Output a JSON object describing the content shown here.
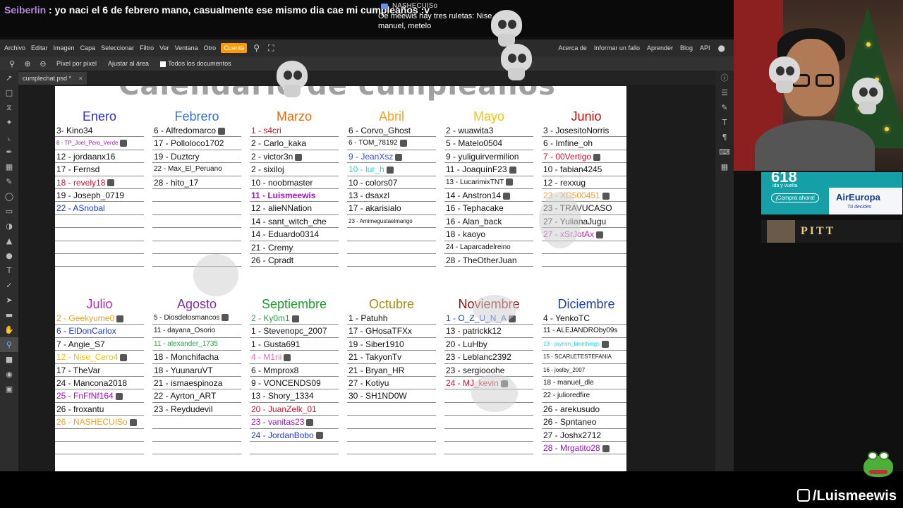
{
  "chat": {
    "username": "Seiberlin",
    "message": ": yo naci el 6 de febrero mano, casualmente ese mismo dia cae mi cumpleaños :v"
  },
  "popup": {
    "username": "NASHECUISo",
    "message": "Oe meewis hay tres ruletas: Nise manuel, metelo"
  },
  "menubar": {
    "items": [
      "Archivo",
      "Editar",
      "Imagen",
      "Capa",
      "Seleccionar",
      "Filtro",
      "Ver",
      "Ventana",
      "Otro",
      "Cuenta"
    ],
    "right_items": [
      "Acerca de",
      "Informar un fallo",
      "Aprender",
      "Blog",
      "API"
    ]
  },
  "optbar": {
    "pixel_label": "Píxel por píxel",
    "fit_label": "Ajustar al área",
    "all_docs_label": "Todos los documentos"
  },
  "tab": {
    "filename": "cumplechat.psd *",
    "close": "×"
  },
  "calendar": {
    "title": "Calendario de cumpleaños",
    "months": [
      {
        "name": "Enero",
        "color": "#2b2bd6",
        "entries": [
          {
            "t": "3- Kino34",
            "c": "#111"
          },
          {
            "t": "8 - TP_Joel_Pero_Verde",
            "c": "#9b1fb0",
            "s": "tiny",
            "a": 1
          },
          {
            "t": "12 - jordaanx16",
            "c": "#111"
          },
          {
            "t": "17 - Fernsd",
            "c": "#111"
          },
          {
            "t": "18 - revely18",
            "c": "#d01030",
            "a": 1
          },
          {
            "t": "19 - Joseph_0719",
            "c": "#111"
          },
          {
            "t": "22 - ASnobal",
            "c": "#1a3fc8"
          },
          {
            "t": "",
            "c": "#111"
          },
          {
            "t": "",
            "c": "#111"
          },
          {
            "t": "",
            "c": "#111"
          },
          {
            "t": "",
            "c": "#111"
          }
        ]
      },
      {
        "name": "Febrero",
        "color": "#3a6fd0",
        "entries": [
          {
            "t": "6 - Alfredomarco",
            "c": "#111",
            "a": 1
          },
          {
            "t": "17 - Polloloco1702",
            "c": "#111"
          },
          {
            "t": "19 - Duztcry",
            "c": "#111"
          },
          {
            "t": "22 - Max_El_Peruano",
            "c": "#111",
            "s": "small"
          },
          {
            "t": "28 - hito_17",
            "c": "#111"
          },
          {
            "t": "",
            "c": "#111"
          },
          {
            "t": "",
            "c": "#111"
          },
          {
            "t": "",
            "c": "#111"
          },
          {
            "t": "",
            "c": "#111"
          },
          {
            "t": "",
            "c": "#111"
          },
          {
            "t": "",
            "c": "#111"
          }
        ]
      },
      {
        "name": "Marzo",
        "color": "#e86a10",
        "entries": [
          {
            "t": "1 - s4cri",
            "c": "#d01030"
          },
          {
            "t": "2 - Carlo_kaka",
            "c": "#111"
          },
          {
            "t": "2 - victor3n",
            "c": "#111",
            "a": 1
          },
          {
            "t": "2 - sixiloj",
            "c": "#111"
          },
          {
            "t": "10 - noobmaster",
            "c": "#111"
          },
          {
            "t": "11 - Luismeewis",
            "c": "#a010c8",
            "b": 1
          },
          {
            "t": "12 - alieNNation",
            "c": "#111"
          },
          {
            "t": "14 - sant_witch_che",
            "c": "#111"
          },
          {
            "t": "14 - Eduardo0314",
            "c": "#111"
          },
          {
            "t": "21 - Cremy",
            "c": "#111"
          },
          {
            "t": "26 - Cpradt",
            "c": "#111"
          }
        ]
      },
      {
        "name": "Abril",
        "color": "#f0a020",
        "entries": [
          {
            "t": "6 - Corvo_Ghost",
            "c": "#111"
          },
          {
            "t": "6 - TOM_78192",
            "c": "#111",
            "s": "small",
            "a": 1
          },
          {
            "t": "9 - JeanXsz",
            "c": "#3050d0",
            "a": 1
          },
          {
            "t": "10 - lur_h",
            "c": "#20d0e0",
            "a": 1
          },
          {
            "t": "10 - colors07",
            "c": "#111"
          },
          {
            "t": "13 - dsaxzl",
            "c": "#111"
          },
          {
            "t": "17 - akarisialo",
            "c": "#111"
          },
          {
            "t": "23 - Amimegustaelmango",
            "c": "#111",
            "s": "tiny"
          },
          {
            "t": "",
            "c": "#111"
          },
          {
            "t": "",
            "c": "#111"
          },
          {
            "t": "",
            "c": "#111"
          }
        ]
      },
      {
        "name": "Mayo",
        "color": "#f0c400",
        "entries": [
          {
            "t": "2 - wuawita3",
            "c": "#111"
          },
          {
            "t": "5 - Matelo0504",
            "c": "#111"
          },
          {
            "t": "9 - yuliguirvermilion",
            "c": "#111"
          },
          {
            "t": "11 - JoaquínF23",
            "c": "#111",
            "a": 1
          },
          {
            "t": "13 - LucarimixTNT",
            "c": "#111",
            "s": "small",
            "a": 1
          },
          {
            "t": "14 - Anstron14",
            "c": "#111",
            "a": 1
          },
          {
            "t": "16 - Tephacake",
            "c": "#111"
          },
          {
            "t": "16 - Alan_back",
            "c": "#111"
          },
          {
            "t": "18 - kaoyo",
            "c": "#111"
          },
          {
            "t": "24 - Laparcadelreino",
            "c": "#111",
            "s": "small"
          },
          {
            "t": "28 - TheOtherJuan",
            "c": "#111"
          }
        ]
      },
      {
        "name": "Junio",
        "color": "#c01010",
        "entries": [
          {
            "t": "3 - JosesitoNorris",
            "c": "#111"
          },
          {
            "t": "6 - Imfine_oh",
            "c": "#111"
          },
          {
            "t": "7 - 00Vertigo",
            "c": "#d01030",
            "a": 1
          },
          {
            "t": "10 - fabian4245",
            "c": "#111"
          },
          {
            "t": "12 - rexxug",
            "c": "#111"
          },
          {
            "t": "23 - XD500451",
            "c": "#f0a020",
            "a": 1
          },
          {
            "t": "23 - TRAVUCASO",
            "c": "#111"
          },
          {
            "t": "27 - YulianaJugu",
            "c": "#111"
          },
          {
            "t": "27 - xSrJotAx",
            "c": "#c020c0",
            "a": 1
          },
          {
            "t": "",
            "c": "#111"
          },
          {
            "t": "",
            "c": "#111"
          }
        ]
      },
      {
        "name": "Julio",
        "color": "#c020c0",
        "entries": [
          {
            "t": "2 - Geekyume0",
            "c": "#f0a020",
            "a": 1
          },
          {
            "t": "6 - ElDonCarlox",
            "c": "#1a3fc8"
          },
          {
            "t": "7 - Angie_S7",
            "c": "#111"
          },
          {
            "t": "12 - Nise_Cero4",
            "c": "#f0c400",
            "a": 1
          },
          {
            "t": "17 - TheVar",
            "c": "#111"
          },
          {
            "t": "24 - Mancona2018",
            "c": "#111"
          },
          {
            "t": "25 - FnFfNf164",
            "c": "#a010c8",
            "a": 1
          },
          {
            "t": "26 - froxantu",
            "c": "#111"
          },
          {
            "t": "26 - NASHECUISo",
            "c": "#f0a020",
            "a": 1
          },
          {
            "t": "",
            "c": "#111"
          },
          {
            "t": "",
            "c": "#111"
          }
        ]
      },
      {
        "name": "Agosto",
        "color": "#7a2aa0",
        "entries": [
          {
            "t": "5 - Diosdelosmancos",
            "c": "#111",
            "s": "small",
            "a": 1
          },
          {
            "t": "11 - dayana_Osorio",
            "c": "#111",
            "s": "small"
          },
          {
            "t": "11 - alexander_1735",
            "c": "#2aa040",
            "s": "small"
          },
          {
            "t": "18 - Monchifacha",
            "c": "#111"
          },
          {
            "t": "18 - YuunaruVT",
            "c": "#111"
          },
          {
            "t": "21 - ismaespinoza",
            "c": "#111"
          },
          {
            "t": "22 - Ayrton_ART",
            "c": "#111"
          },
          {
            "t": "23 - Reydudevil",
            "c": "#111"
          },
          {
            "t": "",
            "c": "#111"
          },
          {
            "t": "",
            "c": "#111"
          },
          {
            "t": "",
            "c": "#111"
          }
        ]
      },
      {
        "name": "Septiembre",
        "color": "#1a9a2a",
        "entries": [
          {
            "t": "2 - Ky0m1",
            "c": "#2aa040",
            "a": 1
          },
          {
            "t": "1 - Stevenopc_2007",
            "c": "#111"
          },
          {
            "t": "1 - Gusta691",
            "c": "#111"
          },
          {
            "t": "4 - M1rii",
            "c": "#e070c0",
            "a": 1
          },
          {
            "t": "6 - Mmprox8",
            "c": "#111"
          },
          {
            "t": "9 - VONCENDS09",
            "c": "#111"
          },
          {
            "t": "13 - Shory_1334",
            "c": "#111"
          },
          {
            "t": "20 - JuanZelk_01",
            "c": "#d01030"
          },
          {
            "t": "23 - vanitas23",
            "c": "#a010c8",
            "a": 1
          },
          {
            "t": "24 - JordanBobo",
            "c": "#1a3fc8",
            "a": 1
          },
          {
            "t": "",
            "c": "#111"
          }
        ]
      },
      {
        "name": "Octubre",
        "color": "#a09010",
        "entries": [
          {
            "t": "1 - Patuhh",
            "c": "#111"
          },
          {
            "t": "17 - GHosaTFXx",
            "c": "#111"
          },
          {
            "t": "19 - Siber1910",
            "c": "#111"
          },
          {
            "t": "21 - TakyonTv",
            "c": "#111"
          },
          {
            "t": "21 - Bryan_HR",
            "c": "#111"
          },
          {
            "t": "27 - Kotiyu",
            "c": "#111"
          },
          {
            "t": "30 - SH1ND0W",
            "c": "#111"
          },
          {
            "t": "",
            "c": "#111"
          },
          {
            "t": "",
            "c": "#111"
          },
          {
            "t": "",
            "c": "#111"
          },
          {
            "t": "",
            "c": "#111"
          }
        ]
      },
      {
        "name": "Noviembre",
        "color": "#8a1010",
        "entries": [
          {
            "t": "1 - O_Z_U_N_A",
            "c": "#1a3fc8",
            "a": 1
          },
          {
            "t": "13 - patrickk12",
            "c": "#111"
          },
          {
            "t": "20 - LuHby",
            "c": "#111"
          },
          {
            "t": "23 - Leblanc2392",
            "c": "#111"
          },
          {
            "t": "23 - sergiooohe",
            "c": "#111"
          },
          {
            "t": "24 - MJ_kevin",
            "c": "#d01030",
            "a": 1
          },
          {
            "t": "",
            "c": "#111"
          },
          {
            "t": "",
            "c": "#111"
          },
          {
            "t": "",
            "c": "#111"
          },
          {
            "t": "",
            "c": "#111"
          },
          {
            "t": "",
            "c": "#111"
          }
        ]
      },
      {
        "name": "Diciembre",
        "color": "#1a3f9a",
        "entries": [
          {
            "t": "4 - YenkoTC",
            "c": "#111"
          },
          {
            "t": "11 - ALEJANDROby09s",
            "c": "#111",
            "s": "small"
          },
          {
            "t": "13 - jaymin_timethings",
            "c": "#20d0e0",
            "s": "tiny",
            "a": 1
          },
          {
            "t": "15 - SCARLETESTEFANIA",
            "c": "#111",
            "s": "tiny"
          },
          {
            "t": "16 - joelby_2007",
            "c": "#111",
            "s": "tiny"
          },
          {
            "t": "18 - manuel_dle",
            "c": "#111",
            "s": "small"
          },
          {
            "t": "22 - julioredfire",
            "c": "#111",
            "s": "small"
          },
          {
            "t": "26 - arekusudo",
            "c": "#111"
          },
          {
            "t": "26 - Spntaneo",
            "c": "#111"
          },
          {
            "t": "27 - Joshx2712",
            "c": "#111"
          },
          {
            "t": "28 - Mrgatito28",
            "c": "#a010c8",
            "a": 1
          }
        ]
      }
    ]
  },
  "ads": {
    "ad1_big": "618",
    "ad1_small": "ida y vuelta",
    "ad1_button": "¡Compra ahora!",
    "ad1_brand": "AirEuropa",
    "ad1_tagline": "Tú decides",
    "ad2_title": "PITT"
  },
  "watermark": {
    "handle": "/Luismeewis"
  }
}
